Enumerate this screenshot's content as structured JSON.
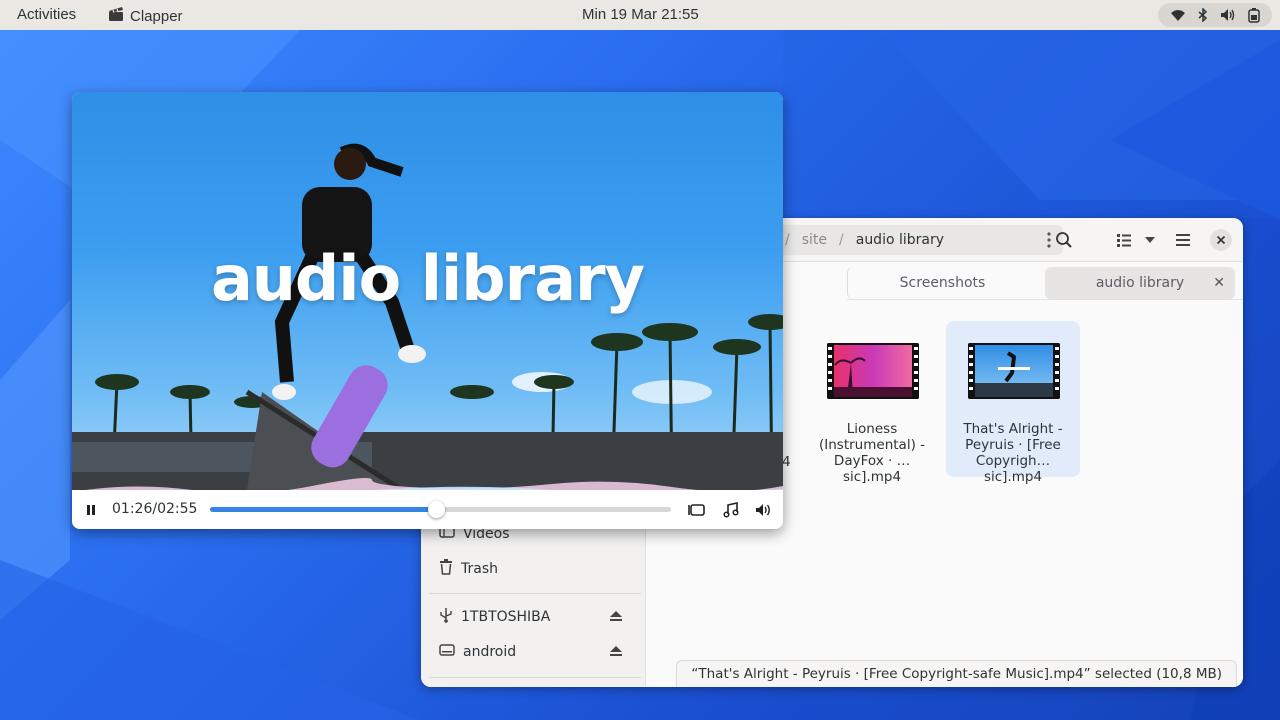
{
  "topbar": {
    "activities": "Activities",
    "app_name": "Clapper",
    "clock": "Min 19 Mar  21:55",
    "icons": [
      "wifi-icon",
      "bluetooth-icon",
      "volume-icon",
      "battery-icon"
    ]
  },
  "player": {
    "video_title": "audio library",
    "time": "01:26/02:55",
    "progress": 0.49,
    "icons": [
      "pause-icon",
      "fullscreen-icon",
      "music-note-icon",
      "volume-icon"
    ]
  },
  "files": {
    "path": {
      "crumb_parent": "site",
      "crumb_current": "audio library"
    },
    "tabs": [
      {
        "label": "Screenshots"
      },
      {
        "label": "audio library"
      }
    ],
    "sidebar": {
      "videos": "Videos",
      "trash": "Trash",
      "drive1": "1TBTOSHIBA",
      "drive2": "android"
    },
    "items": [
      {
        "name": "Lioness (Instrumental) - DayFox · … sic].mp4"
      },
      {
        "name": "That's Alright - Peyruis · [Free Copyrigh… sic].mp4",
        "selected": true
      }
    ],
    "partial_label": "4",
    "status": "“That's Alright - Peyruis · [Free Copyright-safe Music].mp4” selected  (10,8 MB)"
  },
  "colors": {
    "accent": "#3584e4",
    "selection": "#e1ebf9",
    "topbar": "#ebe8e3"
  }
}
